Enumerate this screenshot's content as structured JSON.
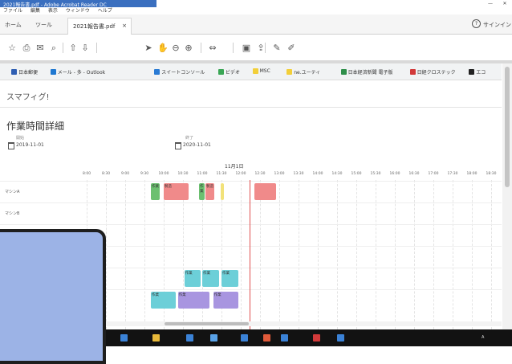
{
  "window": {
    "title": "2021報告書.pdf - Adobe Acrobat Reader DC",
    "minimize": "—",
    "close": "✕"
  },
  "menu": [
    "ファイル",
    "編集",
    "表示",
    "ウィンドウ",
    "ヘルプ"
  ],
  "tabs": {
    "home": "ホーム",
    "tools": "ツール",
    "document": "2021報告書.pdf",
    "close": "×"
  },
  "account": {
    "help": "?",
    "signin": "サインイン"
  },
  "toolbar": {
    "icons": [
      "star-icon",
      "print-icon",
      "mail-icon",
      "search-icon",
      "page-up-icon",
      "page-down-icon",
      "select-cursor-icon",
      "hand-icon",
      "zoom-out-icon",
      "zoom-in-icon",
      "fit-page-icon",
      "save-icon",
      "export-icon",
      "comment-icon",
      "pen-icon"
    ],
    "glyphs": [
      "☆",
      "⎙",
      "✉",
      "⌕",
      "⇧",
      "⇩",
      "➤",
      "✋",
      "⊖",
      "⊕",
      "⇔",
      "▣",
      "⇪",
      "✎",
      "✐"
    ]
  },
  "bookmarks": [
    {
      "label": "日本郵便",
      "color": "#2f5fb3"
    },
    {
      "label": "メール - 多 - Outlook",
      "color": "#1f78d1"
    },
    {
      "label": "スイートコンソール",
      "color": "#2a7bd4"
    },
    {
      "label": "ビデオ",
      "color": "#3aa655"
    },
    {
      "label": "MSC",
      "color": "#f2cf3a"
    },
    {
      "label": "ne.ユーティ",
      "color": "#f2cf3a"
    },
    {
      "label": "日本経済新聞 電子版",
      "color": "#2f8f4a"
    },
    {
      "label": "日経クロステック",
      "color": "#d23a3a"
    },
    {
      "label": "エコ",
      "color": "#222222"
    }
  ],
  "app": {
    "name": "スマフィグ!",
    "heading": "作業時間詳細",
    "start_label": "開始",
    "start_date": "2019-11-01",
    "end_label": "終了",
    "end_date": "2020-11-01"
  },
  "timeline": {
    "date_label": "11月1日",
    "ticks": [
      "8:00",
      "8:30",
      "9:00",
      "9:30",
      "10:00",
      "10:30",
      "11:00",
      "11:30",
      "12:00",
      "12:30",
      "13:00",
      "13:30",
      "14:00",
      "14:30",
      "15:00",
      "15:30",
      "16:00",
      "16:30",
      "17:00",
      "17:30",
      "18:00",
      "18:30"
    ],
    "now": "12:14",
    "rows": [
      "マシンA",
      "マシンB",
      "",
      "",
      "",
      ""
    ],
    "blocks": [
      {
        "row": 0,
        "start": "9:40",
        "end": "9:55",
        "color": "#6cc070",
        "label": "作業"
      },
      {
        "row": 0,
        "start": "10:00",
        "end": "10:40",
        "color": "#f08a8a",
        "label": "製造"
      },
      {
        "row": 0,
        "start": "10:55",
        "end": "11:05",
        "color": "#6cc070",
        "label": "作業"
      },
      {
        "row": 0,
        "start": "11:05",
        "end": "11:20",
        "color": "#f08a8a",
        "label": "製造"
      },
      {
        "row": 0,
        "start": "11:29",
        "end": "11:35",
        "color": "#f2e27a",
        "label": ""
      },
      {
        "row": 0,
        "start": "12:21",
        "end": "12:56",
        "color": "#f08a8a",
        "label": ""
      },
      {
        "row": 4,
        "start": "10:32",
        "end": "10:59",
        "color": "#6ccfd8",
        "label": "作業"
      },
      {
        "row": 4,
        "start": "11:00",
        "end": "11:27",
        "color": "#6ccfd8",
        "label": "作業"
      },
      {
        "row": 4,
        "start": "11:30",
        "end": "11:57",
        "color": "#6ccfd8",
        "label": "作業"
      },
      {
        "row": 5,
        "start": "9:40",
        "end": "10:20",
        "color": "#6ccfd8",
        "label": "作業"
      },
      {
        "row": 5,
        "start": "10:22",
        "end": "11:13",
        "color": "#a895e0",
        "label": "作業"
      },
      {
        "row": 5,
        "start": "11:17",
        "end": "11:57",
        "color": "#a895e0",
        "label": "作業"
      }
    ]
  },
  "colors": {
    "titlebar": "#3a6fbf",
    "now_line": "#e05050",
    "overlay": "#9cb3e6",
    "taskbar": "#121212"
  },
  "taskbar": {
    "items": [
      {
        "icon": "app-icon-1",
        "color": "#3b82d6"
      },
      {
        "icon": "app-icon-2",
        "color": "#e8b93a"
      },
      {
        "icon": "app-icon-3",
        "color": "#3b82d6"
      },
      {
        "icon": "app-icon-4",
        "color": "#5aa3e8"
      },
      {
        "icon": "app-icon-5",
        "color": "#3b82d6"
      },
      {
        "icon": "app-icon-6",
        "color": "#e05a3a"
      },
      {
        "icon": "app-icon-7",
        "color": "#3b82d6"
      },
      {
        "icon": "app-icon-8",
        "color": "#d23a3a"
      },
      {
        "icon": "app-icon-9",
        "color": "#3b82d6"
      }
    ],
    "ime": "A"
  }
}
